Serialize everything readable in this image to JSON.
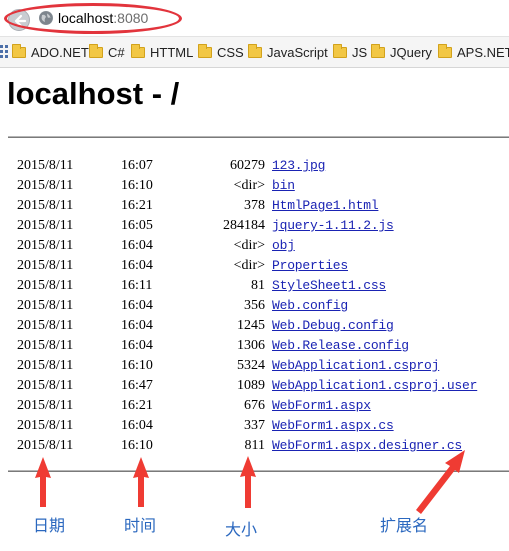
{
  "browser": {
    "url_host": "localhost",
    "url_port": ":8080"
  },
  "bookmarks": [
    {
      "label": "ADO.NET"
    },
    {
      "label": "C#"
    },
    {
      "label": "HTTML"
    },
    {
      "label": "CSS"
    },
    {
      "label": "JavaScript"
    },
    {
      "label": "JS"
    },
    {
      "label": "JQuery"
    },
    {
      "label": "APS.NET"
    }
  ],
  "page": {
    "title": "localhost - /"
  },
  "listing": [
    {
      "date": "2015/8/11",
      "time": "16:07",
      "size": "60279",
      "name": "123.jpg"
    },
    {
      "date": "2015/8/11",
      "time": "16:10",
      "size": "<dir>",
      "name": "bin"
    },
    {
      "date": "2015/8/11",
      "time": "16:21",
      "size": "378",
      "name": "HtmlPage1.html"
    },
    {
      "date": "2015/8/11",
      "time": "16:05",
      "size": "284184",
      "name": "jquery-1.11.2.js"
    },
    {
      "date": "2015/8/11",
      "time": "16:04",
      "size": "<dir>",
      "name": "obj"
    },
    {
      "date": "2015/8/11",
      "time": "16:04",
      "size": "<dir>",
      "name": "Properties"
    },
    {
      "date": "2015/8/11",
      "time": "16:11",
      "size": "81",
      "name": "StyleSheet1.css"
    },
    {
      "date": "2015/8/11",
      "time": "16:04",
      "size": "356",
      "name": "Web.config"
    },
    {
      "date": "2015/8/11",
      "time": "16:04",
      "size": "1245",
      "name": "Web.Debug.config"
    },
    {
      "date": "2015/8/11",
      "time": "16:04",
      "size": "1306",
      "name": "Web.Release.config"
    },
    {
      "date": "2015/8/11",
      "time": "16:10",
      "size": "5324",
      "name": "WebApplication1.csproj"
    },
    {
      "date": "2015/8/11",
      "time": "16:47",
      "size": "1089",
      "name": "WebApplication1.csproj.user"
    },
    {
      "date": "2015/8/11",
      "time": "16:21",
      "size": "676",
      "name": "WebForm1.aspx"
    },
    {
      "date": "2015/8/11",
      "time": "16:04",
      "size": "337",
      "name": "WebForm1.aspx.cs"
    },
    {
      "date": "2015/8/11",
      "time": "16:10",
      "size": "811",
      "name": "WebForm1.aspx.designer.cs"
    }
  ],
  "annotations": {
    "date": "日期",
    "time": "时间",
    "size": "大小",
    "extension": "扩展名"
  },
  "colors": {
    "link": "#1a23b3",
    "annotation": "#2b68bf",
    "highlight": "#e2343c",
    "folder": "#f2c744"
  },
  "icons": {
    "back": "back-arrow-icon",
    "site": "globe-icon",
    "bookmark": "folder-icon",
    "apps": "apps-grid-icon"
  }
}
